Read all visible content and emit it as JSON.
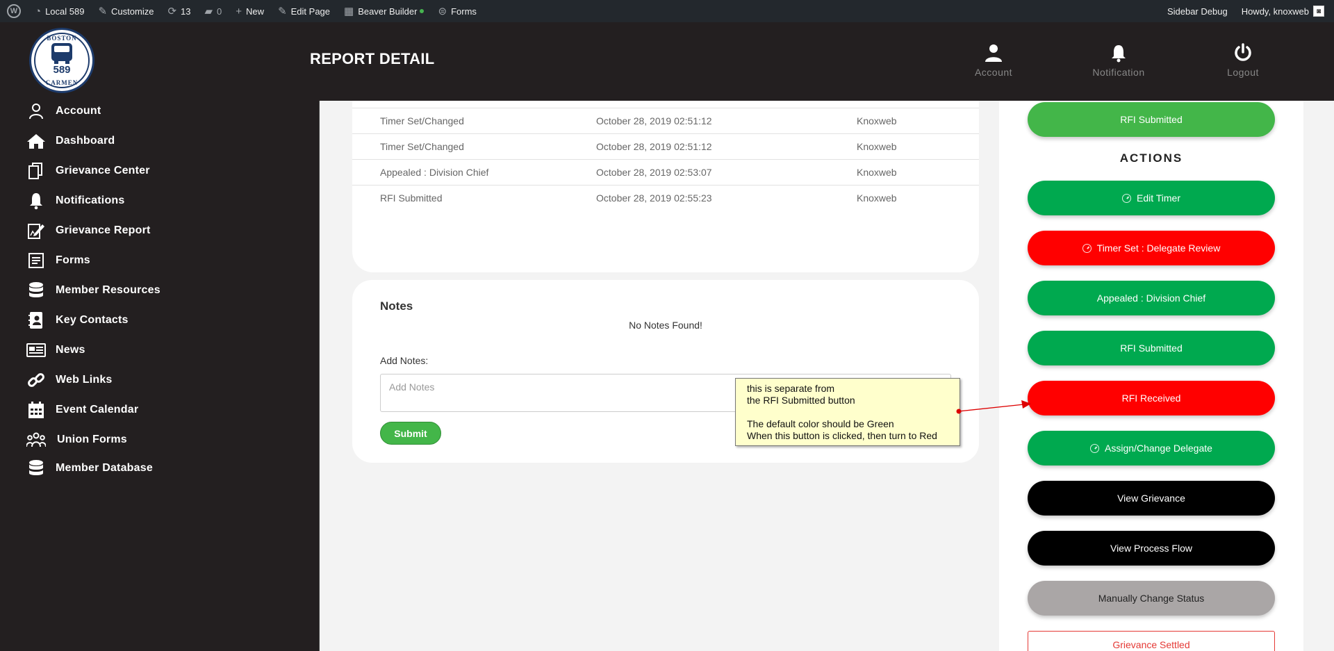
{
  "adminbar": {
    "site": "Local 589",
    "customize": "Customize",
    "updates": "13",
    "comments": "0",
    "new": "New",
    "edit_page": "Edit Page",
    "beaver": "Beaver Builder",
    "forms": "Forms",
    "sidebar_debug": "Sidebar Debug",
    "howdy": "Howdy, knoxweb"
  },
  "logo": {
    "top": "BOSTON",
    "number": "589",
    "bottom": "CARMEN"
  },
  "header": {
    "title": "REPORT DETAIL",
    "nav": [
      {
        "label": "Account",
        "icon": "user-icon"
      },
      {
        "label": "Notification",
        "icon": "bell-icon"
      },
      {
        "label": "Logout",
        "icon": "power-icon"
      }
    ]
  },
  "sidebar": {
    "items": [
      {
        "label": "Account",
        "icon": "user-icon"
      },
      {
        "label": "Dashboard",
        "icon": "home-icon"
      },
      {
        "label": "Grievance Center",
        "icon": "copy-icon"
      },
      {
        "label": "Notifications",
        "icon": "bell-icon"
      },
      {
        "label": "Grievance Report",
        "icon": "edit-report-icon"
      },
      {
        "label": "Forms",
        "icon": "form-icon"
      },
      {
        "label": "Member Resources",
        "icon": "database-icon"
      },
      {
        "label": "Key Contacts",
        "icon": "contact-book-icon"
      },
      {
        "label": "News",
        "icon": "newspaper-icon"
      },
      {
        "label": "Web Links",
        "icon": "link-icon"
      },
      {
        "label": "Event Calendar",
        "icon": "calendar-icon"
      },
      {
        "label": "Union Forms",
        "icon": "people-icon"
      },
      {
        "label": "Member Database",
        "icon": "database-icon"
      }
    ]
  },
  "history": [
    {
      "action": "Timer Set/Changed",
      "date": "October 28, 2019 02:51:12",
      "user": "Knoxweb"
    },
    {
      "action": "Timer Set/Changed",
      "date": "October 28, 2019 02:51:12",
      "user": "Knoxweb"
    },
    {
      "action": "Appealed : Division Chief",
      "date": "October 28, 2019 02:53:07",
      "user": "Knoxweb"
    },
    {
      "action": "RFI Submitted",
      "date": "October 28, 2019 02:55:23",
      "user": "Knoxweb"
    }
  ],
  "notes": {
    "title": "Notes",
    "empty": "No Notes Found!",
    "label": "Add Notes:",
    "placeholder": "Add Notes",
    "submit": "Submit"
  },
  "actions": {
    "status_button": "RFI Submitted",
    "title": "ACTIONS",
    "buttons": [
      {
        "label": "Edit Timer",
        "color": "#00a94f",
        "clock": true
      },
      {
        "label": "Timer Set : Delegate Review",
        "color": "#ff0000",
        "clock": true
      },
      {
        "label": "Appealed : Division Chief",
        "color": "#00a94f",
        "clock": false
      },
      {
        "label": "RFI Submitted",
        "color": "#00a94f",
        "clock": false
      },
      {
        "label": "RFI Received",
        "color": "#ff0000",
        "clock": false
      },
      {
        "label": "Assign/Change Delegate",
        "color": "#00a94f",
        "clock": true
      },
      {
        "label": "View Grievance",
        "color": "#000000",
        "clock": false
      },
      {
        "label": "View Process Flow",
        "color": "#000000",
        "clock": false
      },
      {
        "label": "Manually Change Status",
        "color": "#aaa6a6",
        "clock": false
      }
    ],
    "settled": "Grievance Settled"
  },
  "annotation": {
    "line1": "this is separate from",
    "line2": "the RFI Submitted button",
    "line3": "The default color should be Green",
    "line4": "When this button is clicked, then turn to Red"
  },
  "colors": {
    "dark": "#231f20",
    "green": "#00a94f",
    "light_green": "#43b649",
    "red": "#ff0000",
    "note_yellow": "#ffffcc"
  }
}
